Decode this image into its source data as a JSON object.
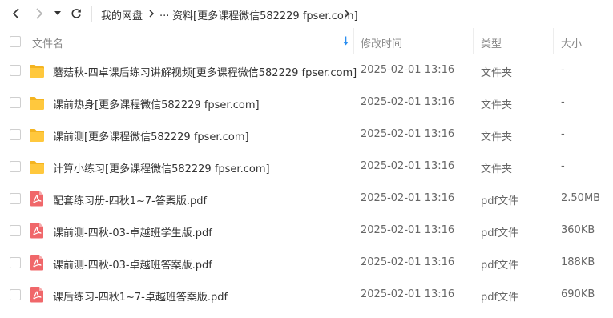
{
  "nav": {
    "back_icon": "chevron-left-icon",
    "forward_icon": "chevron-right-icon",
    "dropdown_icon": "caret-down-icon",
    "refresh_icon": "refresh-icon",
    "breadcrumb": {
      "root": "我的网盘",
      "ellipsis": "...",
      "current": "资料[更多课程微信582229 fpser.com]"
    }
  },
  "table": {
    "headers": {
      "name": "文件名",
      "modified": "修改时间",
      "type": "类型",
      "size": "大小"
    },
    "sort_icon": "sort-down-arrow-icon",
    "rows": [
      {
        "name": "蘑菇秋-四卓课后练习讲解视频[更多课程微信582229 fpser.com]",
        "modified": "2025-02-01 13:16",
        "type": "文件夹",
        "size": "-",
        "icon": "folder-icon"
      },
      {
        "name": "课前热身[更多课程微信582229 fpser.com]",
        "modified": "2025-02-01 13:16",
        "type": "文件夹",
        "size": "-",
        "icon": "folder-icon"
      },
      {
        "name": "课前测[更多课程微信582229 fpser.com]",
        "modified": "2025-02-01 13:16",
        "type": "文件夹",
        "size": "-",
        "icon": "folder-icon"
      },
      {
        "name": "计算小练习[更多课程微信582229 fpser.com]",
        "modified": "2025-02-01 13:16",
        "type": "文件夹",
        "size": "-",
        "icon": "folder-icon"
      },
      {
        "name": "配套练习册-四秋1~7-答案版.pdf",
        "modified": "2025-02-01 13:16",
        "type": "pdf文件",
        "size": "2.50MB",
        "icon": "pdf-file-icon"
      },
      {
        "name": "课前测-四秋-03-卓越班学生版.pdf",
        "modified": "2025-02-01 13:16",
        "type": "pdf文件",
        "size": "360KB",
        "icon": "pdf-file-icon"
      },
      {
        "name": "课前测-四秋-03-卓越班答案版.pdf",
        "modified": "2025-02-01 13:16",
        "type": "pdf文件",
        "size": "188KB",
        "icon": "pdf-file-icon"
      },
      {
        "name": "课后练习-四秋1~7-卓越班答案版.pdf",
        "modified": "2025-02-01 13:16",
        "type": "pdf文件",
        "size": "690KB",
        "icon": "pdf-file-icon"
      }
    ]
  },
  "colors": {
    "folder": "#ffc83d",
    "folder_back": "#f4b420",
    "pdf": "#f0676a",
    "accent": "#2a8ef0"
  }
}
